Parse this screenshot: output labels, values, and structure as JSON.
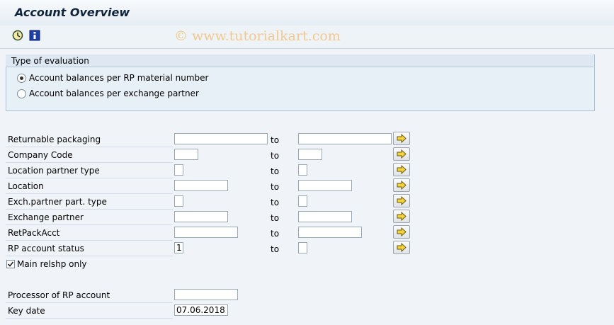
{
  "window": {
    "title": "Account Overview"
  },
  "toolbar": {
    "execute_icon": "clock-execute-icon",
    "info_icon": "info-icon",
    "watermark": "© www.tutorialkart.com"
  },
  "evaluation": {
    "title": "Type of evaluation",
    "options": [
      {
        "label": "Account balances per RP material number",
        "selected": true
      },
      {
        "label": "Account balances per exchange partner",
        "selected": false
      }
    ]
  },
  "fields": {
    "to_label": "to",
    "rows": [
      {
        "label": "Returnable packaging",
        "from": "",
        "to": ""
      },
      {
        "label": "Company Code",
        "from": "",
        "to": ""
      },
      {
        "label": "Location partner type",
        "from": "",
        "to": ""
      },
      {
        "label": "Location",
        "from": "",
        "to": ""
      },
      {
        "label": "Exch.partner part. type",
        "from": "",
        "to": ""
      },
      {
        "label": "Exchange partner",
        "from": "",
        "to": ""
      },
      {
        "label": "RetPackAcct",
        "from": "",
        "to": ""
      },
      {
        "label": "RP account status",
        "from": "1",
        "to": ""
      }
    ],
    "main_relshp": {
      "label": "Main relshp only",
      "checked": true
    },
    "processor": {
      "label": "Processor of RP account",
      "value": ""
    },
    "key_date": {
      "label": "Key date",
      "value": "07.06.2018"
    }
  },
  "colors": {
    "title": "#10233a",
    "watermark": "#f2c88f",
    "arrow": "#f5d33a"
  }
}
